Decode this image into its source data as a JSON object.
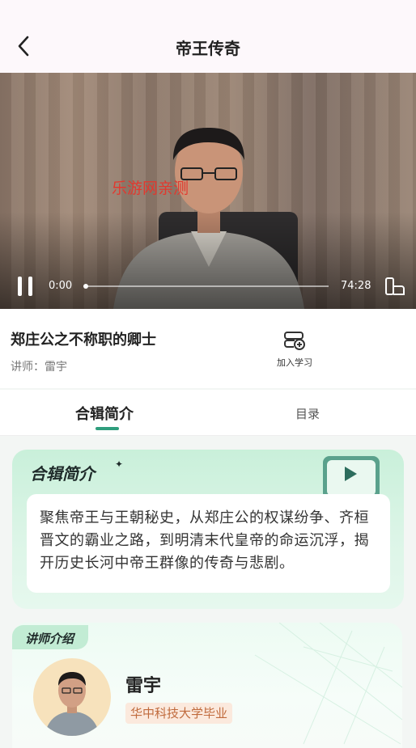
{
  "header": {
    "title": "帝王传奇",
    "back_icon": "chevron-left-icon"
  },
  "video": {
    "watermark": "乐游网亲测",
    "current_time": "0:00",
    "total_time": "74:28",
    "progress": 0,
    "state": "playing"
  },
  "episode": {
    "title": "郑庄公之不称职的卿士",
    "lecturer_line": "讲师：雷宇",
    "add_label": "加入学习"
  },
  "tabs": [
    {
      "label": "合辑简介",
      "active": true
    },
    {
      "label": "目录",
      "active": false
    }
  ],
  "intro": {
    "heading": "合辑简介",
    "star": "✦",
    "text": "聚焦帝王与王朝秘史，从郑庄公的权谋纷争、齐桓晋文的霸业之路，到明清末代皇帝的命运沉浮，揭开历史长河中帝王群像的传奇与悲剧。"
  },
  "lecturer": {
    "tag": "讲师介绍",
    "name": "雷宇",
    "credential": "华中科技大学毕业"
  },
  "colors": {
    "accent": "#2f9e7d",
    "watermark": "#e2382e"
  }
}
